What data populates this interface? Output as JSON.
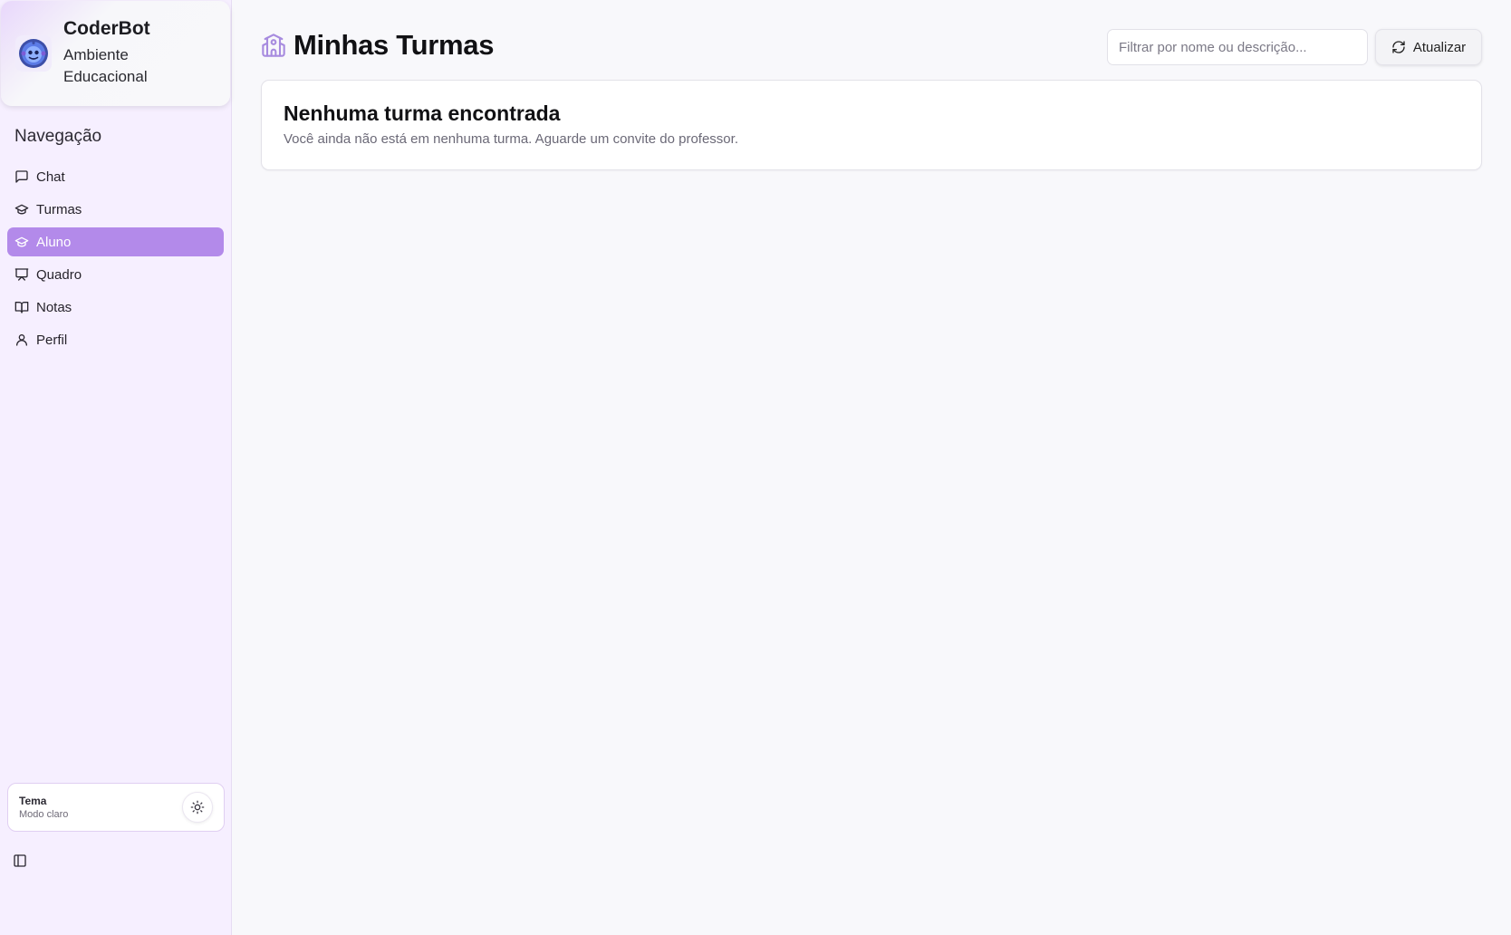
{
  "brand": {
    "name": "CoderBot",
    "subtitle": "Ambiente Educacional"
  },
  "sidebar": {
    "title": "Navegação",
    "items": [
      {
        "label": "Chat",
        "icon": "message-square-icon",
        "active": false
      },
      {
        "label": "Turmas",
        "icon": "graduation-cap-icon",
        "active": false
      },
      {
        "label": "Aluno",
        "icon": "graduation-cap-icon",
        "active": true
      },
      {
        "label": "Quadro",
        "icon": "presentation-icon",
        "active": false
      },
      {
        "label": "Notas",
        "icon": "book-open-icon",
        "active": false
      },
      {
        "label": "Perfil",
        "icon": "user-icon",
        "active": false
      }
    ],
    "theme": {
      "label": "Tema",
      "mode": "Modo claro",
      "icon": "sun-icon"
    }
  },
  "main": {
    "title": "Minhas Turmas",
    "title_icon": "school-icon",
    "filter_placeholder": "Filtrar por nome ou descrição...",
    "refresh_label": "Atualizar",
    "empty": {
      "title": "Nenhuma turma encontrada",
      "description": "Você ainda não está em nenhuma turma. Aguarde um convite do professor."
    }
  },
  "colors": {
    "accent": "#b38aea",
    "sidebar_bg": "#f6efff",
    "page_bg": "#f8f8fb"
  }
}
